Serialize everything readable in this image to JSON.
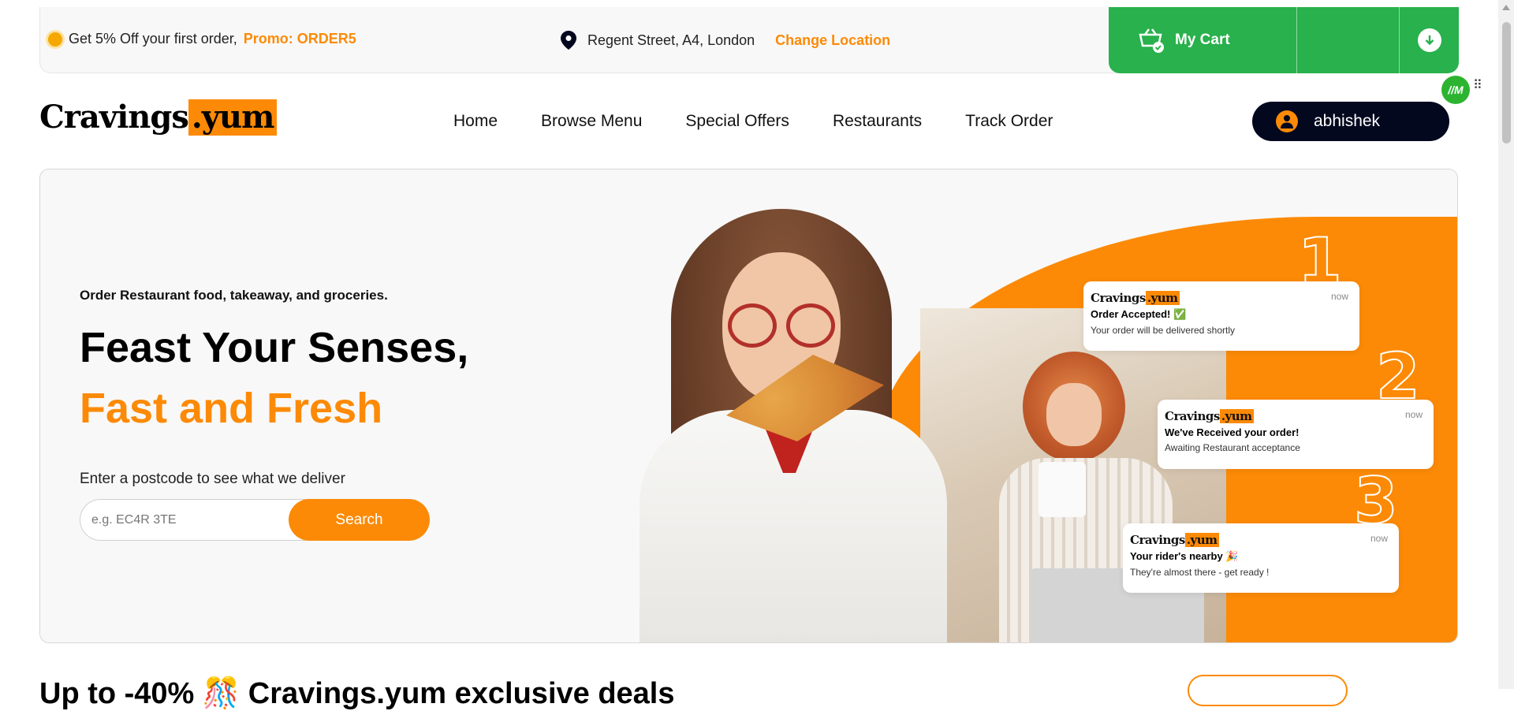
{
  "topbar": {
    "promo_text": "Get 5% Off your first order,",
    "promo_code": "Promo: ORDER5",
    "location": "Regent Street, A4, London",
    "change_location": "Change Location",
    "cart_label": "My Cart",
    "icons": [
      "sun-icon",
      "location-pin-icon",
      "basket-icon",
      "download-arrow-icon"
    ]
  },
  "brand": {
    "logo_part1": "Cravings",
    "logo_part2": ".yum",
    "accent": "#fc8a06",
    "dark": "#03081f",
    "cart_green": "#28b14c"
  },
  "nav": {
    "items": [
      "Home",
      "Browse Menu",
      "Special Offers",
      "Restaurants",
      "Track Order"
    ]
  },
  "user": {
    "name": "abhishek"
  },
  "extension": {
    "badge": "//M"
  },
  "hero": {
    "subtitle": "Order Restaurant food, takeaway, and groceries.",
    "title_line1": "Feast Your Senses,",
    "title_line2": "Fast and Fresh",
    "postcode_label": "Enter a postcode to see what we deliver",
    "postcode_placeholder": "e.g. EC4R 3TE",
    "search_button": "Search",
    "steps": [
      "1",
      "2",
      "3"
    ],
    "notifications": [
      {
        "logo": "Cravings",
        "logo_accent": ".yum",
        "time": "now",
        "title": "Order Accepted! ✅",
        "text": "Your order will be delivered shortly"
      },
      {
        "logo": "Cravings",
        "logo_accent": ".yum",
        "time": "now",
        "title": "We've Received your order!",
        "text": "Awaiting Restaurant acceptance"
      },
      {
        "logo": "Cravings",
        "logo_accent": ".yum",
        "time": "now",
        "title": "Your rider's nearby 🎉",
        "text": "They're almost there - get ready !"
      }
    ]
  },
  "deals": {
    "heading": "Up to -40% 🎊 Cravings.yum exclusive deals"
  }
}
